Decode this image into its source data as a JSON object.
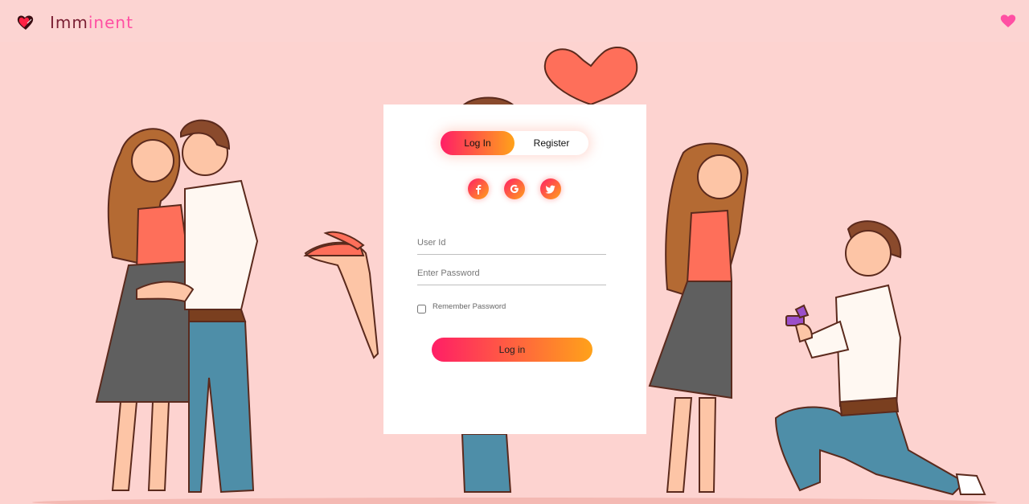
{
  "brand": {
    "name_start": "Imm",
    "name_accent": "inent"
  },
  "nav": {
    "right_icon": "heart-icon"
  },
  "auth": {
    "tab_login": "Log In",
    "tab_register": "Register",
    "social": [
      "facebook-icon",
      "google-icon",
      "twitter-icon"
    ],
    "user_placeholder": "User Id",
    "password_placeholder": "Enter Password",
    "remember_label": "Remember Password",
    "submit_label": "Log in"
  },
  "colors": {
    "background": "#fdd3d0",
    "gradient_start": "#ff1e66",
    "gradient_end": "#ffa21a",
    "heart": "#ff4fa3"
  }
}
